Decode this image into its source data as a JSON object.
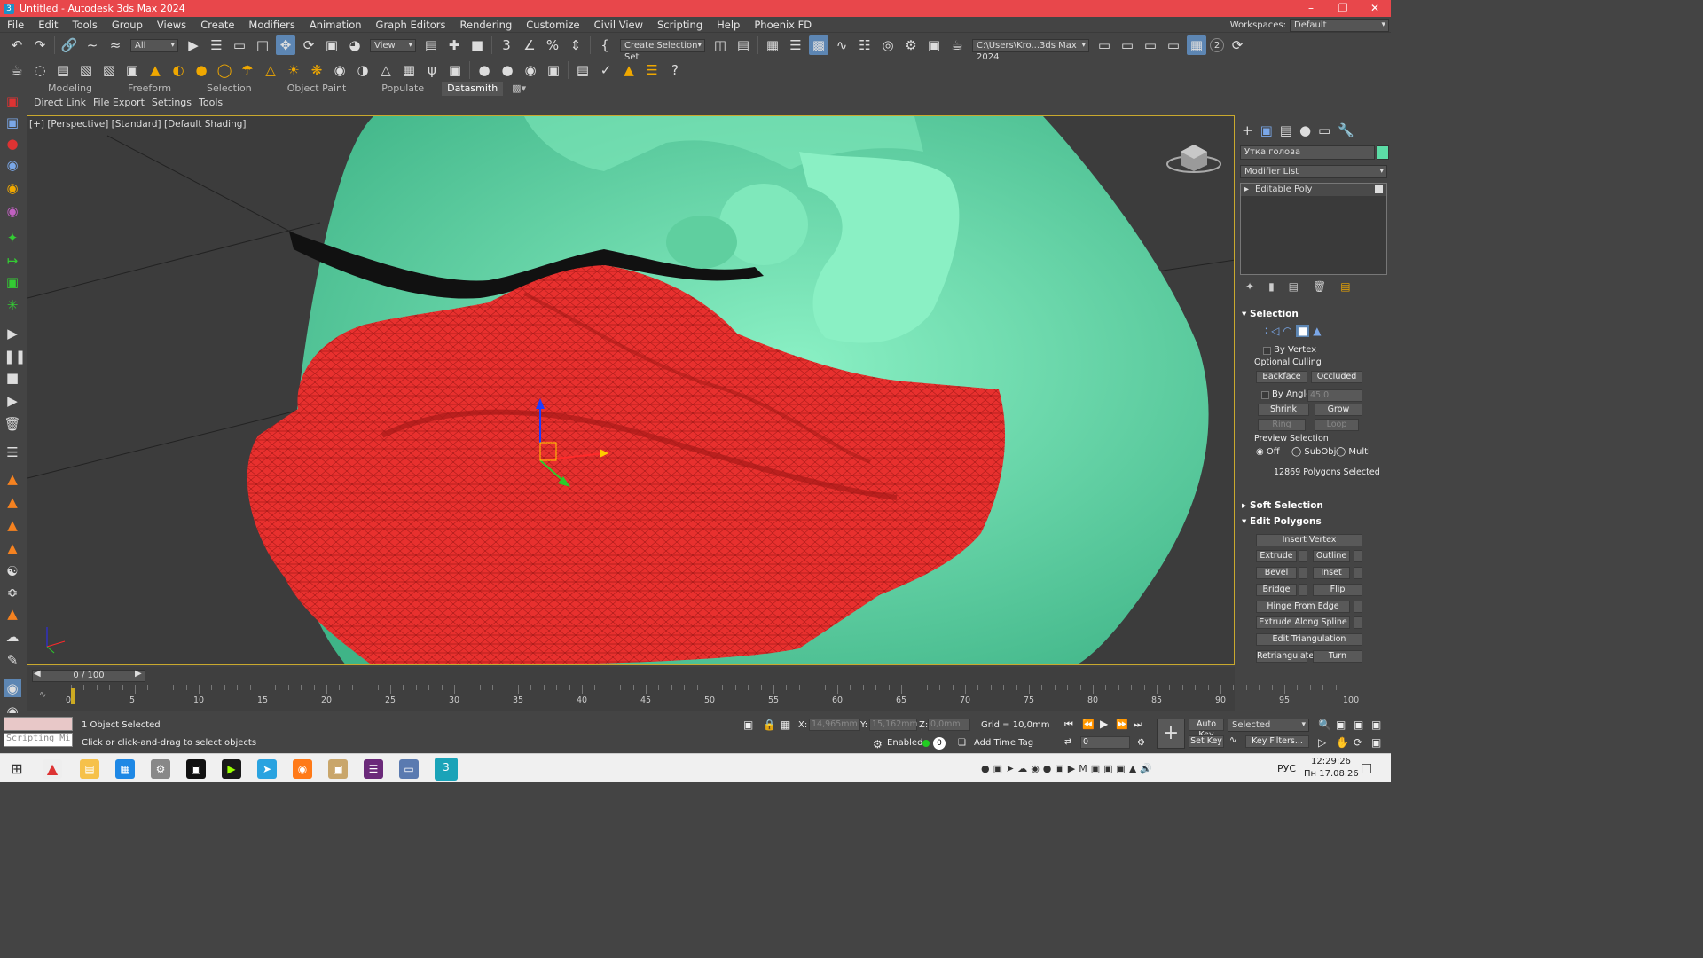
{
  "window": {
    "title": "Untitled - Autodesk 3ds Max 2024",
    "app_letter": "3"
  },
  "menu": {
    "items": [
      "File",
      "Edit",
      "Tools",
      "Group",
      "Views",
      "Create",
      "Modifiers",
      "Animation",
      "Graph Editors",
      "Rendering",
      "Customize",
      "Civil View",
      "Scripting",
      "Help",
      "Phoenix FD"
    ],
    "workspaces_label": "Workspaces:",
    "workspace_value": "Default"
  },
  "toolbar1": {
    "filter_value": "All",
    "refcoord_value": "View",
    "selection_set_placeholder": "Create Selection Set",
    "project_path": "C:\\Users\\Kro...3ds Max 2024",
    "badge_count": "2"
  },
  "ribbon": {
    "tabs": [
      "Modeling",
      "Freeform",
      "Selection",
      "Object Paint",
      "Populate",
      "Datasmith"
    ],
    "active": "Datasmith",
    "subtabs": [
      "Direct Link",
      "File Export",
      "Settings",
      "Tools"
    ]
  },
  "viewport": {
    "label": "[+] [Perspective] [Standard] [Default Shading]"
  },
  "command_panel": {
    "object_name": "Утка голова",
    "object_color": "#5cdca6",
    "modifier_list_label": "Modifier List",
    "stack_item": "Editable Poly",
    "selection": {
      "title": "Selection",
      "by_vertex": "By Vertex",
      "optional_culling": "Optional Culling",
      "backface": "Backface",
      "occluded": "Occluded",
      "by_angle": "By Angle:",
      "angle_value": "45,0",
      "shrink": "Shrink",
      "grow": "Grow",
      "ring": "Ring",
      "loop": "Loop",
      "preview_selection": "Preview Selection",
      "off": "Off",
      "subobj": "SubObj",
      "multi": "Multi",
      "status": "12869 Polygons Selected"
    },
    "soft_selection": "Soft Selection",
    "edit_polygons": {
      "title": "Edit Polygons",
      "insert_vertex": "Insert Vertex",
      "extrude": "Extrude",
      "outline": "Outline",
      "bevel": "Bevel",
      "inset": "Inset",
      "bridge": "Bridge",
      "flip": "Flip",
      "hinge": "Hinge From Edge",
      "extrude_spline": "Extrude Along Spline",
      "edit_tri": "Edit Triangulation",
      "retriangulate": "Retriangulate",
      "turn": "Turn"
    }
  },
  "timeline": {
    "frame_display": "0 / 100",
    "ticks": [
      "0",
      "5",
      "10",
      "15",
      "20",
      "25",
      "30",
      "35",
      "40",
      "45",
      "50",
      "55",
      "60",
      "65",
      "70",
      "75",
      "80",
      "85",
      "90",
      "95",
      "100"
    ]
  },
  "status": {
    "script_listener": "Scripting Mi",
    "selected": "1 Object Selected",
    "prompt": "Click or click-and-drag to select objects",
    "x_label": "X:",
    "x_value": "14,965mm",
    "y_label": "Y:",
    "y_value": "15,162mm",
    "z_label": "Z:",
    "z_value": "0,0mm",
    "grid": "Grid = 10,0mm",
    "enabled": "Enabled:",
    "add_time_tag": "Add Time Tag",
    "auto_key": "Auto Key",
    "set_key": "Set Key",
    "key_filter_value": "Selected",
    "key_filters": "Key Filters...",
    "frame_value": "0"
  },
  "taskbar": {
    "lang": "РУС",
    "time": "12:29:26",
    "date": "Пн 17.08.26"
  },
  "colors": {
    "mesh_green": "#5cdca6",
    "selection_red": "#e8302e",
    "title_red": "#e8474b",
    "active_blue": "#5d86b3"
  }
}
